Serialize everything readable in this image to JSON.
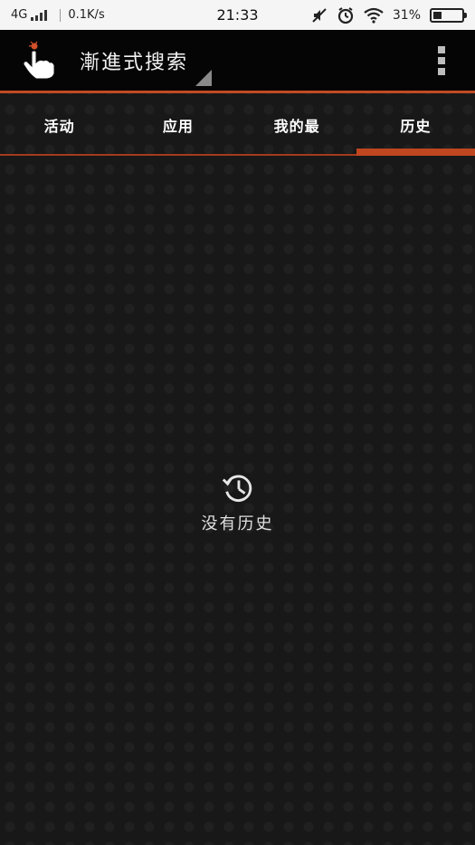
{
  "status_bar": {
    "network": "4G",
    "speed": "0.1K/s",
    "time": "21:33",
    "battery": "31%"
  },
  "header": {
    "app_icon": "pointing-hand-icon",
    "title": "漸進式搜索"
  },
  "tabs": [
    {
      "label": "活动",
      "active": false
    },
    {
      "label": "应用",
      "active": false
    },
    {
      "label": "我的最",
      "active": false
    },
    {
      "label": "历史",
      "active": true
    }
  ],
  "empty_state": {
    "icon": "history-clock-icon",
    "message": "没有历史"
  },
  "colors": {
    "accent": "#c0461f",
    "background": "#131313",
    "action_bar": "#050505"
  }
}
